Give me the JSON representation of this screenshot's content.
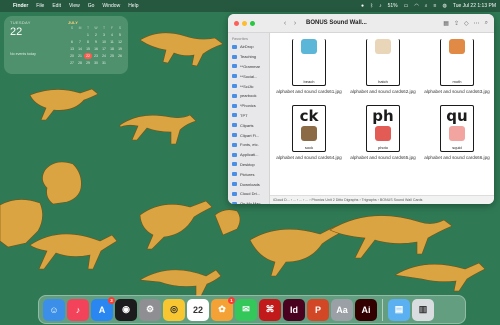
{
  "menubar": {
    "apple": "",
    "app_name": "Finder",
    "items": [
      "File",
      "Edit",
      "View",
      "Go",
      "Window",
      "Help"
    ],
    "battery": "51%",
    "clock": "Tue Jul 22  1:13 PM"
  },
  "calendar_widget": {
    "weekday": "TUESDAY",
    "day": "22",
    "no_events": "No events today",
    "month": "JULY",
    "headers": [
      "S",
      "M",
      "T",
      "W",
      "T",
      "F",
      "S"
    ],
    "weeks": [
      [
        "",
        "",
        "1",
        "2",
        "3",
        "4",
        "5"
      ],
      [
        "6",
        "7",
        "8",
        "9",
        "10",
        "11",
        "12"
      ],
      [
        "13",
        "14",
        "15",
        "16",
        "17",
        "18",
        "19"
      ],
      [
        "20",
        "21",
        "22",
        "23",
        "24",
        "25",
        "26"
      ],
      [
        "27",
        "28",
        "29",
        "30",
        "31",
        "",
        ""
      ]
    ],
    "today": "22"
  },
  "finder": {
    "title": "BONUS Sound Wall...",
    "sidebar_heading": "Favorites",
    "sidebar_items": [
      "AirDrop",
      "Teaching",
      "**Grammar",
      "**Social...",
      "**SciJlc",
      "yearbook",
      "*Phonics",
      "TPT",
      "Cliparts",
      "Clipart Fi...",
      "Fonts, etc.",
      "Applicati...",
      "Desktop",
      "Pictures",
      "Downloads",
      "Cloud Dri...",
      "On My Mac"
    ],
    "files": [
      {
        "letters": "",
        "word": "beach",
        "name": "alphabet and sound cards61.jpg",
        "pic_color": "#5bb6d8"
      },
      {
        "letters": "",
        "word": "hatch",
        "name": "alphabet and sound cards62.jpg",
        "pic_color": "#e9d6b8"
      },
      {
        "letters": "",
        "word": "moth",
        "name": "alphabet and sound cards63.jpg",
        "pic_color": "#e08a45"
      },
      {
        "letters": "ck",
        "word": "sock",
        "name": "alphabet and sound cards64.jpg",
        "pic_color": "#8b6a46"
      },
      {
        "letters": "ph",
        "word": "photo",
        "name": "alphabet and sound cards65.jpg",
        "pic_color": "#e25b55"
      },
      {
        "letters": "qu",
        "word": "squid",
        "name": "alphabet and sound cards66.jpg",
        "pic_color": "#f2a5a0"
      }
    ],
    "pathbar": "iCloud D... › ... › ... › ... › Phonics Unit 2 Ditto Digraphs › Trigraphs › BONUS Sound Wall Cards"
  },
  "dock": {
    "apps": [
      {
        "name": "finder-icon",
        "glyph": "☺",
        "color": "#3b8fe8",
        "badge": ""
      },
      {
        "name": "music-icon",
        "glyph": "♪",
        "color": "#f2435a",
        "badge": ""
      },
      {
        "name": "app-store-icon",
        "glyph": "A",
        "color": "#2a86f0",
        "badge": "3"
      },
      {
        "name": "camera-icon",
        "glyph": "◉",
        "color": "#1c1c1e",
        "badge": ""
      },
      {
        "name": "settings-icon",
        "glyph": "⚙",
        "color": "#8e8e93",
        "badge": ""
      },
      {
        "name": "chrome-icon",
        "glyph": "◎",
        "color": "#f7c631",
        "badge": ""
      },
      {
        "name": "calendar-icon",
        "glyph": "22",
        "color": "#ffffff",
        "badge": ""
      },
      {
        "name": "photos-icon",
        "glyph": "✿",
        "color": "#f4a236",
        "badge": "1"
      },
      {
        "name": "messages-icon",
        "glyph": "✉",
        "color": "#34c759",
        "badge": ""
      },
      {
        "name": "acrobat-icon",
        "glyph": "⌘",
        "color": "#c21a1a",
        "badge": ""
      },
      {
        "name": "indesign-icon",
        "glyph": "Id",
        "color": "#49021f",
        "badge": ""
      },
      {
        "name": "powerpoint-icon",
        "glyph": "P",
        "color": "#d24726",
        "badge": ""
      },
      {
        "name": "font-book-icon",
        "glyph": "Aa",
        "color": "#9aa0a6",
        "badge": ""
      },
      {
        "name": "illustrator-icon",
        "glyph": "Ai",
        "color": "#330000",
        "badge": ""
      }
    ],
    "extras": [
      {
        "name": "downloads-folder-icon",
        "glyph": "▤",
        "color": "#5ab0f0"
      },
      {
        "name": "trash-icon",
        "glyph": "▥",
        "color": "#d9dde0"
      }
    ]
  }
}
